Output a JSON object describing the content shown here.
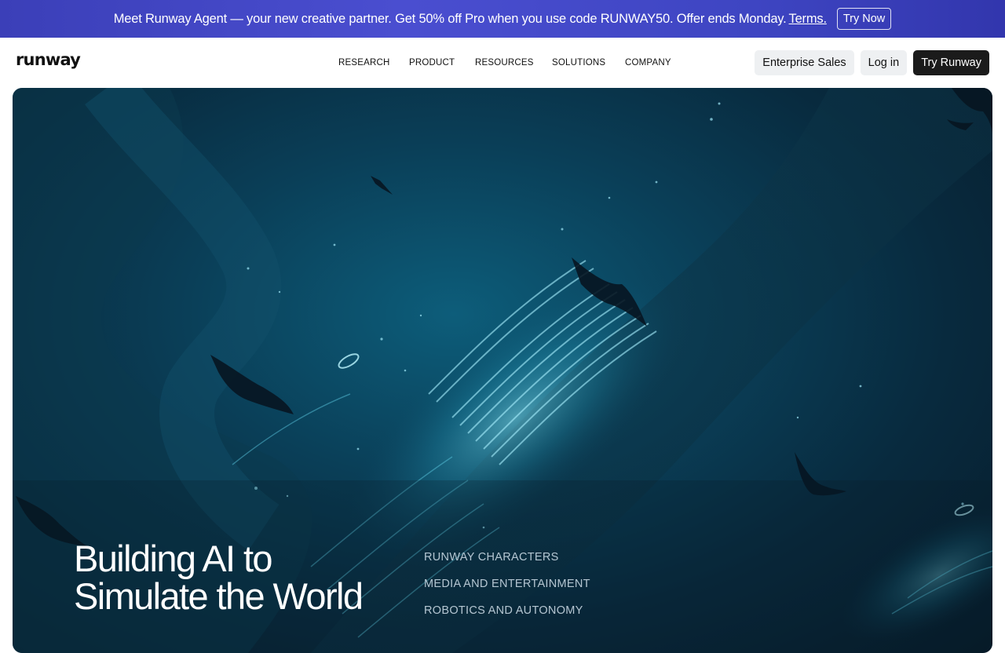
{
  "promo": {
    "text": "Meet Runway Agent — your new creative partner. Get 50% off Pro when you use code RUNWAY50. Offer ends Monday.",
    "terms_label": "Terms.",
    "cta_label": "Try Now"
  },
  "header": {
    "logo": "runway",
    "nav": [
      "RESEARCH",
      "PRODUCT",
      "RESOURCES",
      "SOLUTIONS",
      "COMPANY"
    ],
    "enterprise_label": "Enterprise Sales",
    "login_label": "Log in",
    "try_label": "Try Runway"
  },
  "hero": {
    "title_line1": "Building AI to",
    "title_line2": "Simulate the World",
    "links": [
      "RUNWAY CHARACTERS",
      "MEDIA AND ENTERTAINMENT",
      "ROBOTICS AND AUTONOMY"
    ]
  },
  "colors": {
    "banner": "#4a4ed0",
    "hero_bg": "#082a3e",
    "hero_glow": "#0d5d7a",
    "dark_button": "#1b1b1b",
    "light_button": "#eef0f2"
  }
}
